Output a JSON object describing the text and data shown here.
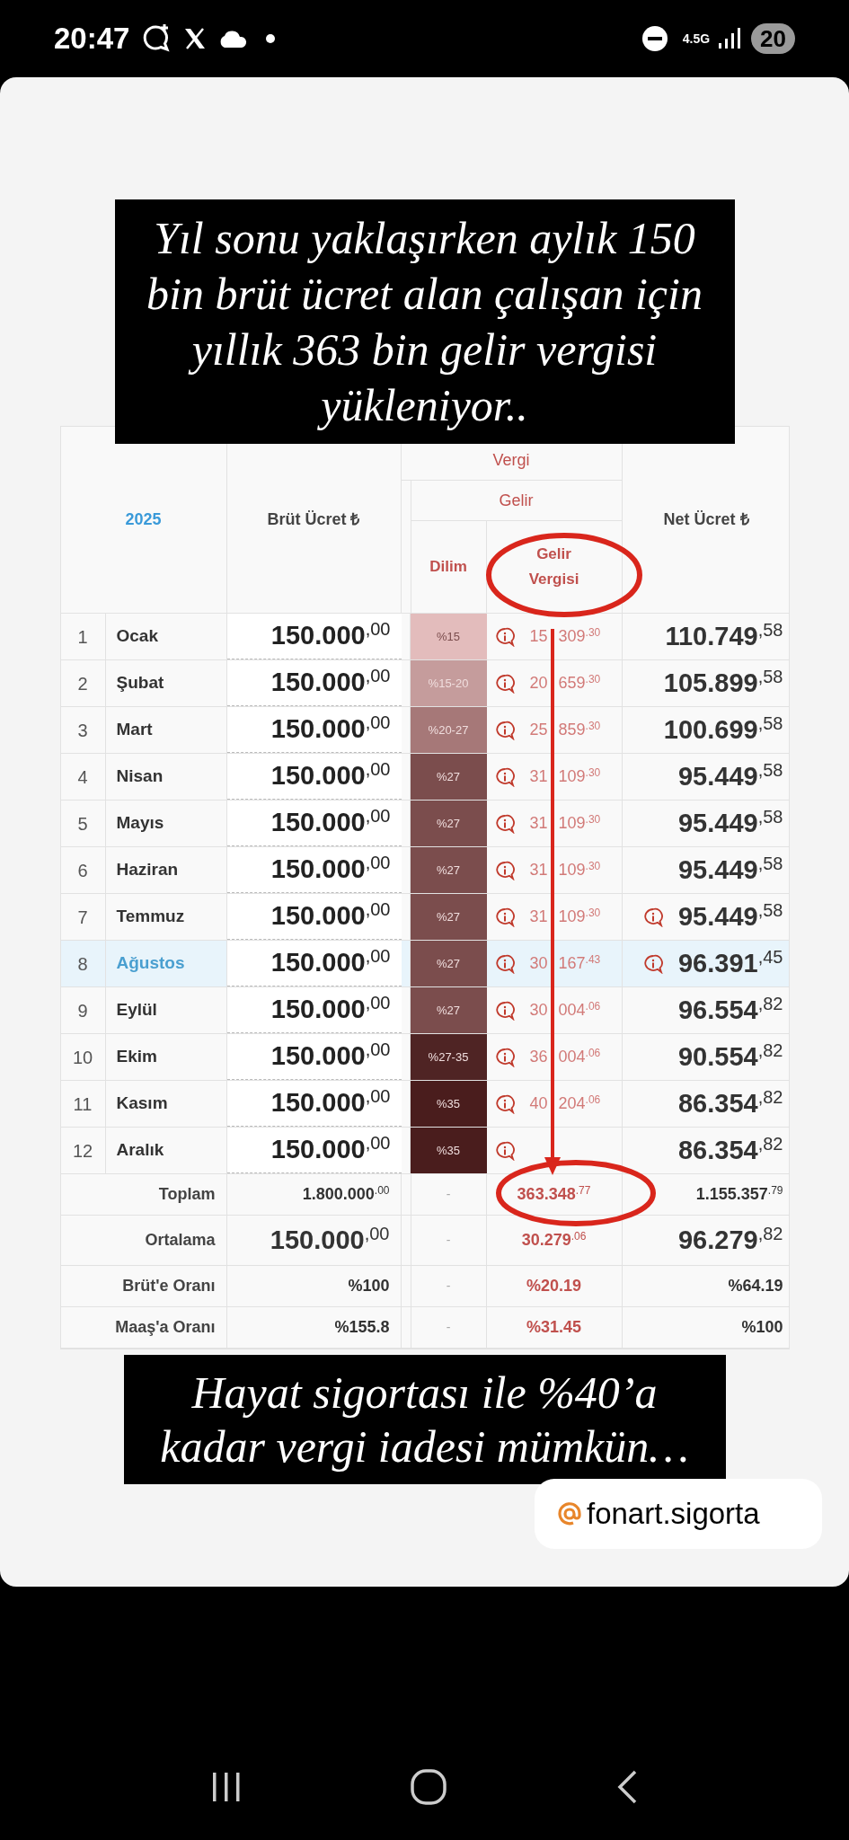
{
  "status_bar": {
    "time": "20:47",
    "network": "4.5G",
    "battery": "20"
  },
  "caption_top": "Yıl sonu yaklaşırken aylık 150 bin brüt ücret alan çalışan için yıllık 363 bin gelir vergisi yükleniyor..",
  "table": {
    "year": "2025",
    "brut_header": "Brüt Ücret ₺",
    "vergi_header": "Vergi",
    "gelir_header": "Gelir",
    "dilim_header": "Dilim",
    "gelir_vergisi_header": "Gelir Vergisi",
    "net_header": "Net Ücret ₺",
    "rows": [
      {
        "no": "1",
        "month": "Ocak",
        "selected": false,
        "brut": "150.000",
        "brut_dec": ",00",
        "dilim": "%15",
        "color": "#e3bcbc",
        "gelir_lead": "15",
        "gelir": "309",
        "gelir_dec": ".30",
        "net": "110.749",
        "net_dec": ",58",
        "net_info": false
      },
      {
        "no": "2",
        "month": "Şubat",
        "selected": false,
        "brut": "150.000",
        "brut_dec": ",00",
        "dilim": "%15-20",
        "color": "#c59c9c",
        "gelir_lead": "20",
        "gelir": "659",
        "gelir_dec": ".30",
        "net": "105.899",
        "net_dec": ",58",
        "net_info": false
      },
      {
        "no": "3",
        "month": "Mart",
        "selected": false,
        "brut": "150.000",
        "brut_dec": ",00",
        "dilim": "%20-27",
        "color": "#a67878",
        "gelir_lead": "25",
        "gelir": "859",
        "gelir_dec": ".30",
        "net": "100.699",
        "net_dec": ",58",
        "net_info": false
      },
      {
        "no": "4",
        "month": "Nisan",
        "selected": false,
        "brut": "150.000",
        "brut_dec": ",00",
        "dilim": "%27",
        "color": "#7b4d4d",
        "gelir_lead": "31",
        "gelir": "109",
        "gelir_dec": ".30",
        "net": "95.449",
        "net_dec": ",58",
        "net_info": false
      },
      {
        "no": "5",
        "month": "Mayıs",
        "selected": false,
        "brut": "150.000",
        "brut_dec": ",00",
        "dilim": "%27",
        "color": "#7b4d4d",
        "gelir_lead": "31",
        "gelir": "109",
        "gelir_dec": ".30",
        "net": "95.449",
        "net_dec": ",58",
        "net_info": false
      },
      {
        "no": "6",
        "month": "Haziran",
        "selected": false,
        "brut": "150.000",
        "brut_dec": ",00",
        "dilim": "%27",
        "color": "#7b4d4d",
        "gelir_lead": "31",
        "gelir": "109",
        "gelir_dec": ".30",
        "net": "95.449",
        "net_dec": ",58",
        "net_info": false
      },
      {
        "no": "7",
        "month": "Temmuz",
        "selected": false,
        "brut": "150.000",
        "brut_dec": ",00",
        "dilim": "%27",
        "color": "#7b4d4d",
        "gelir_lead": "31",
        "gelir": "109",
        "gelir_dec": ".30",
        "net": "95.449",
        "net_dec": ",58",
        "net_info": true
      },
      {
        "no": "8",
        "month": "Ağustos",
        "selected": true,
        "brut": "150.000",
        "brut_dec": ",00",
        "dilim": "%27",
        "color": "#7b4d4d",
        "gelir_lead": "30",
        "gelir": "167",
        "gelir_dec": ".43",
        "net": "96.391",
        "net_dec": ",45",
        "net_info": true
      },
      {
        "no": "9",
        "month": "Eylül",
        "selected": false,
        "brut": "150.000",
        "brut_dec": ",00",
        "dilim": "%27",
        "color": "#7b4d4d",
        "gelir_lead": "30",
        "gelir": "004",
        "gelir_dec": ".06",
        "net": "96.554",
        "net_dec": ",82",
        "net_info": false
      },
      {
        "no": "10",
        "month": "Ekim",
        "selected": false,
        "brut": "150.000",
        "brut_dec": ",00",
        "dilim": "%27-35",
        "color": "#4f2424",
        "gelir_lead": "36",
        "gelir": "004",
        "gelir_dec": ".06",
        "net": "90.554",
        "net_dec": ",82",
        "net_info": false
      },
      {
        "no": "11",
        "month": "Kasım",
        "selected": false,
        "brut": "150.000",
        "brut_dec": ",00",
        "dilim": "%35",
        "color": "#4a1d1d",
        "gelir_lead": "40",
        "gelir": "204",
        "gelir_dec": ".06",
        "net": "86.354",
        "net_dec": ",82",
        "net_info": false
      },
      {
        "no": "12",
        "month": "Aralık",
        "selected": false,
        "brut": "150.000",
        "brut_dec": ",00",
        "dilim": "%35",
        "color": "#4a1d1d",
        "net": "86.354",
        "net_dec": ",82",
        "net_info": false
      }
    ],
    "summary": [
      {
        "kind": "total",
        "label": "Toplam",
        "brut": "1.800.000",
        "brut_dec": ".00",
        "dilim": "-",
        "gelir": "363.348",
        "gelir_dec": ".77",
        "net": "1.155.357",
        "net_dec": ".79"
      },
      {
        "kind": "large",
        "label": "Ortalama",
        "brut": "150.000",
        "brut_dec": ",00",
        "dilim": "-",
        "gelir": "30.279",
        "gelir_dec": ".06",
        "net": "96.279",
        "net_dec": ",82"
      },
      {
        "kind": "ratio",
        "label": "Brüt'e Oranı",
        "brut": "%100",
        "dilim": "-",
        "gelir": "%20.19",
        "net": "%64.19"
      },
      {
        "kind": "ratio",
        "label": "Maaş'a Oranı",
        "brut": "%155.8",
        "dilim": "-",
        "gelir": "%31.45",
        "net": "%100"
      }
    ]
  },
  "caption_bottom": "Hayat sigortası ile %40’a kadar vergi iadesi mümkün…",
  "handle": "fonart.sigorta"
}
